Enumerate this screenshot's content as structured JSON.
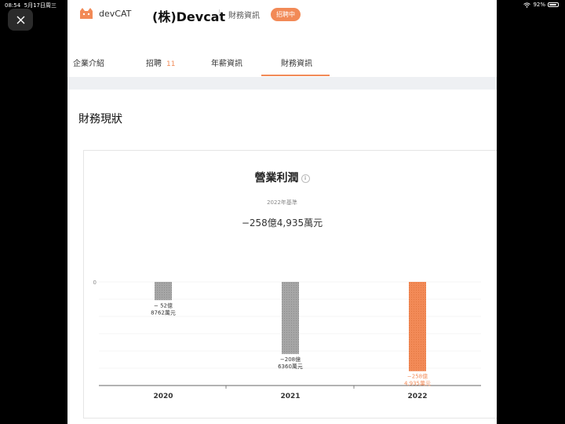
{
  "status_bar": {
    "time": "08:54",
    "date": "5月17日周三",
    "battery": "92%"
  },
  "header": {
    "logo_text": "devCAT",
    "company": "(株)Devcat",
    "subtitle": "財務資訊",
    "badge": "招聘中"
  },
  "tabs": [
    {
      "label": "企業介紹",
      "count": ""
    },
    {
      "label": "招聘",
      "count": "11"
    },
    {
      "label": "年薪資訊",
      "count": ""
    },
    {
      "label": "財務資訊",
      "count": ""
    }
  ],
  "section_title": "財務現狀",
  "card": {
    "title": "營業利潤",
    "info_icon": "i",
    "basis": "2022年基準",
    "total": "−258億4,935萬元"
  },
  "colors": {
    "accent": "#f28a57",
    "bar_gray": "#a6a6a6"
  },
  "chart_data": {
    "type": "bar",
    "categories": [
      "2020",
      "2021",
      "2022"
    ],
    "values": [
      -52.8762,
      -208.636,
      -258.4935
    ],
    "value_labels": [
      [
        "− 52億",
        "8762萬元"
      ],
      [
        "−208億",
        "6360萬元"
      ],
      [
        "−258億",
        "4,935萬元"
      ]
    ],
    "zero_label": "0",
    "highlight": "2022",
    "grid": true
  }
}
